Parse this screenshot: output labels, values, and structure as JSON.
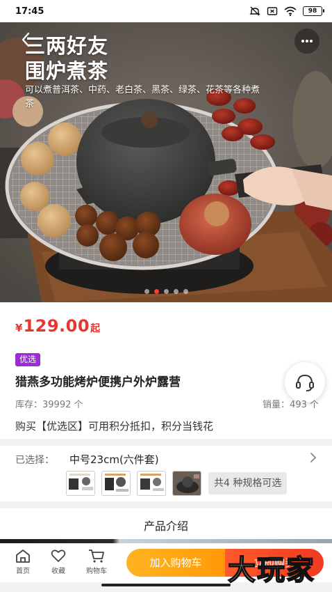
{
  "status_bar": {
    "time": "17:45",
    "battery": "98",
    "icons": [
      "mute-icon",
      "screen-record-icon",
      "wifi-icon",
      "battery-icon"
    ]
  },
  "hero": {
    "title_line1": "三两好友",
    "title_line2": "围炉煮茶",
    "subtitle": "可以煮普洱茶、中药、老白茶、黑茶、绿茶、花茶等各种煮茶",
    "back_icon": "chevron-left-icon",
    "more_icon": "more-icon",
    "slide_count": 5,
    "active_slide": 1
  },
  "product": {
    "price_currency": "¥",
    "price_value": "129.00",
    "price_suffix": "起",
    "tag": "优选",
    "title": "猎燕多功能烤炉便携户外炉露营",
    "stock": "库存：39992 个",
    "sold": "销量：493 个",
    "points_note": "购买【优选区】可用积分抵扣，积分当钱花",
    "service_icon": "customer-service-icon"
  },
  "spec": {
    "label": "已选择：",
    "value": "中号23cm(六件套)",
    "count_text": "共4 种规格可选",
    "arrow_icon": "chevron-right-icon",
    "thumbnails": [
      "spec-thumb-1",
      "spec-thumb-2",
      "spec-thumb-3",
      "spec-thumb-4"
    ]
  },
  "intro": {
    "title": "产品介绍"
  },
  "bottom_bar": {
    "nav": [
      {
        "label": "首页",
        "icon": "home-icon"
      },
      {
        "label": "收藏",
        "icon": "heart-icon"
      },
      {
        "label": "购物车",
        "icon": "cart-icon"
      }
    ],
    "add_to_cart": "加入购物车",
    "buy_now": "立即购买"
  },
  "watermark": "大玩家",
  "colors": {
    "price": "#e8352f",
    "tag": "#9c2bd8",
    "cart_button": "#ffa61a",
    "buy_button": "#f03a22",
    "active_dot": "#ff3b30"
  }
}
